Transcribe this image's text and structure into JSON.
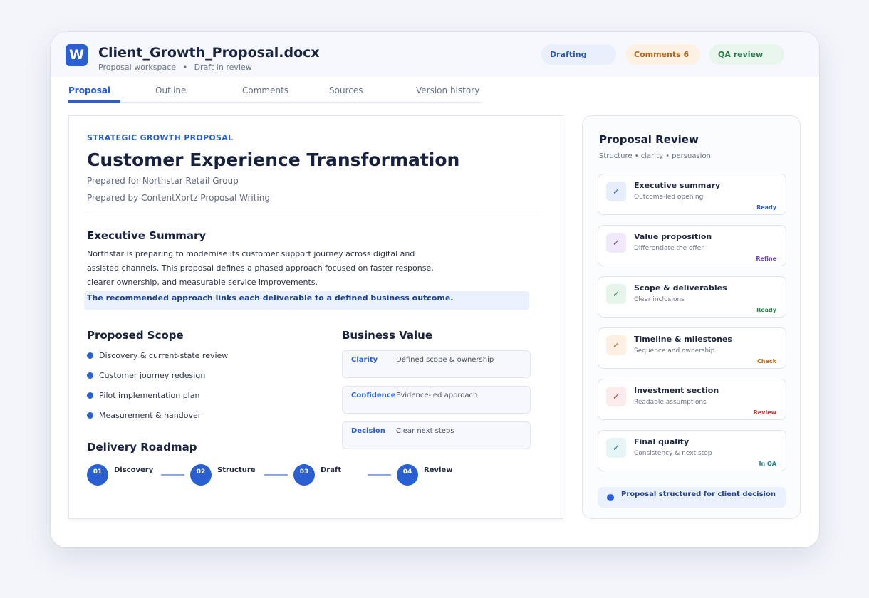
{
  "header": {
    "app_icon_letter": "W",
    "title": "Client_Growth_Proposal.docx",
    "subtitle_left": "Proposal workspace",
    "subtitle_sep": "•",
    "subtitle_right": "Draft in review",
    "pills": [
      {
        "label": "Drafting"
      },
      {
        "label": "Comments 6"
      },
      {
        "label": "QA review"
      }
    ]
  },
  "tabs": [
    {
      "label": "Proposal",
      "active": true
    },
    {
      "label": "Outline"
    },
    {
      "label": "Comments"
    },
    {
      "label": "Sources"
    },
    {
      "label": "Version history"
    }
  ],
  "document": {
    "kicker": "STRATEGIC GROWTH PROPOSAL",
    "title": "Customer Experience Transformation",
    "prepared_for": "Prepared for Northstar Retail Group",
    "prepared_by": "Prepared by ContentXprtz Proposal Writing",
    "exec_heading": "Executive Summary",
    "exec_lines": [
      "Northstar is preparing to modernise its customer support journey across digital and",
      "assisted channels. This proposal defines a phased approach focused on faster response,",
      "clearer ownership, and measurable service improvements."
    ],
    "highlight": "The recommended approach links each deliverable to a defined business outcome.",
    "scope_heading": "Proposed Scope",
    "scope_items": [
      "Discovery & current-state review",
      "Customer journey redesign",
      "Pilot implementation plan",
      "Measurement & handover"
    ],
    "value_heading": "Business Value",
    "values": [
      {
        "key": "Clarity",
        "value": "Defined scope & ownership"
      },
      {
        "key": "Confidence",
        "value": "Evidence-led approach"
      },
      {
        "key": "Decision",
        "value": "Clear next steps"
      }
    ],
    "roadmap_heading": "Delivery Roadmap",
    "roadmap": [
      {
        "num": "01",
        "label": "Discovery"
      },
      {
        "num": "02",
        "label": "Structure"
      },
      {
        "num": "03",
        "label": "Draft"
      },
      {
        "num": "04",
        "label": "Review"
      }
    ]
  },
  "review": {
    "title": "Proposal Review",
    "subtitle": "Structure • clarity • persuasion",
    "check_glyph": "✓",
    "items": [
      {
        "title": "Executive summary",
        "sub": "Outcome-led opening",
        "status": "Ready",
        "color": "#2a5fd2",
        "bg": "#e6eefc"
      },
      {
        "title": "Value proposition",
        "sub": "Differentiate the offer",
        "status": "Refine",
        "color": "#6b3fc2",
        "bg": "#efe9fb"
      },
      {
        "title": "Scope & deliverables",
        "sub": "Clear inclusions",
        "status": "Ready",
        "color": "#2a8a4c",
        "bg": "#e6f5ea"
      },
      {
        "title": "Timeline & milestones",
        "sub": "Sequence and ownership",
        "status": "Check",
        "color": "#c06a1c",
        "bg": "#fdf0e2"
      },
      {
        "title": "Investment section",
        "sub": "Readable assumptions",
        "status": "Review",
        "color": "#c23a3a",
        "bg": "#fcebeb"
      },
      {
        "title": "Final quality",
        "sub": "Consistency & next step",
        "status": "In QA",
        "color": "#1f7f86",
        "bg": "#e5f4f5"
      }
    ],
    "banner": "Proposal structured for client decision"
  }
}
